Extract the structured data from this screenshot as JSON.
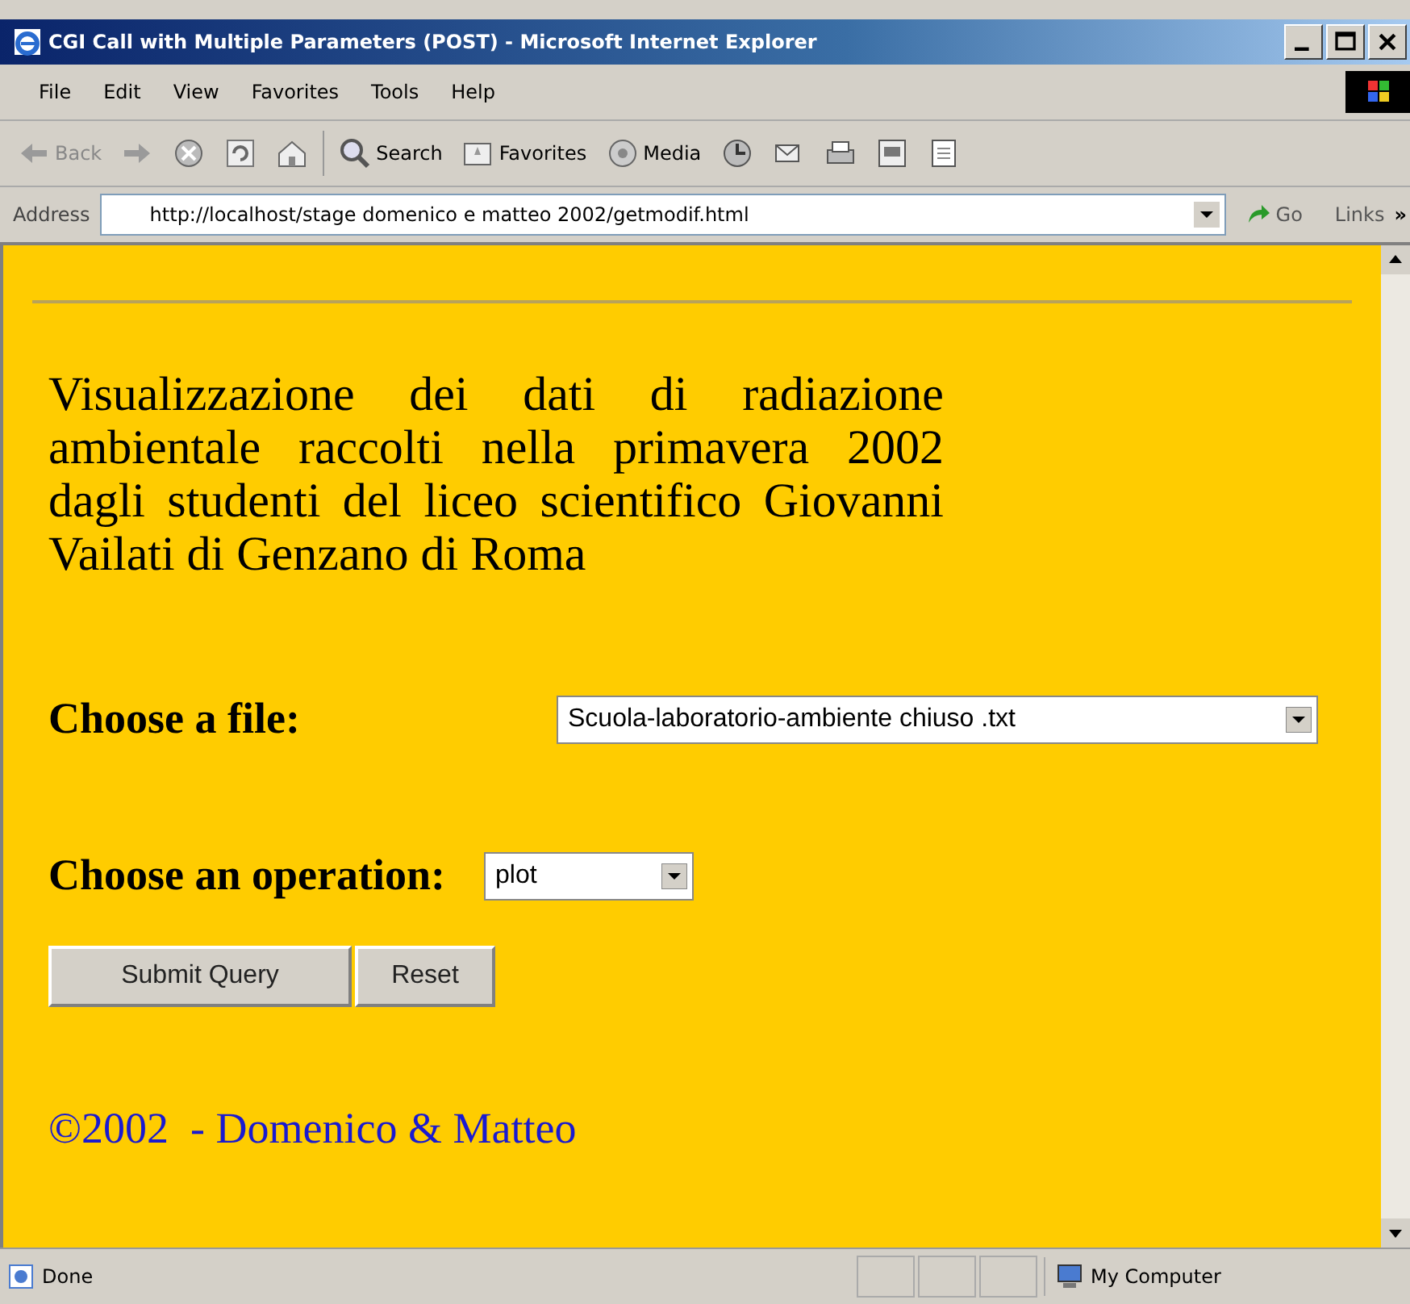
{
  "window": {
    "title": "CGI Call with Multiple Parameters (POST) - Microsoft Internet Explorer"
  },
  "menu": [
    "File",
    "Edit",
    "View",
    "Favorites",
    "Tools",
    "Help"
  ],
  "toolbar": [
    {
      "kind": "back",
      "label": "Back"
    },
    {
      "kind": "forward"
    },
    {
      "kind": "stop"
    },
    {
      "kind": "refresh"
    },
    {
      "kind": "home"
    },
    {
      "kind": "search",
      "label": "Search"
    },
    {
      "kind": "favorites",
      "label": "Favorites"
    },
    {
      "kind": "media",
      "label": "Media"
    },
    {
      "kind": "history"
    },
    {
      "kind": "mail"
    },
    {
      "kind": "print"
    },
    {
      "kind": "edit"
    },
    {
      "kind": "discuss"
    }
  ],
  "address": {
    "label": "Address",
    "value": "http://localhost/stage domenico e matteo 2002/getmodif.html",
    "go": "Go",
    "links": "Links",
    "more": "»"
  },
  "page": {
    "intro": "Visualizzazione dei dati di radiazione ambientale raccolti nella primavera 2002 dagli studenti del liceo scientifico Giovanni Vailati di Genzano di Roma",
    "file_label": "Choose a file:",
    "file_value": "Scuola-laboratorio-ambiente chiuso .txt",
    "operation_label": "Choose an operation:",
    "operation_value": "plot",
    "buttons": [
      "Submit Query",
      "Reset"
    ],
    "footer": "©2002  - Domenico & Matteo"
  },
  "status_bar": {
    "text": "Done",
    "zone": "My Computer"
  }
}
